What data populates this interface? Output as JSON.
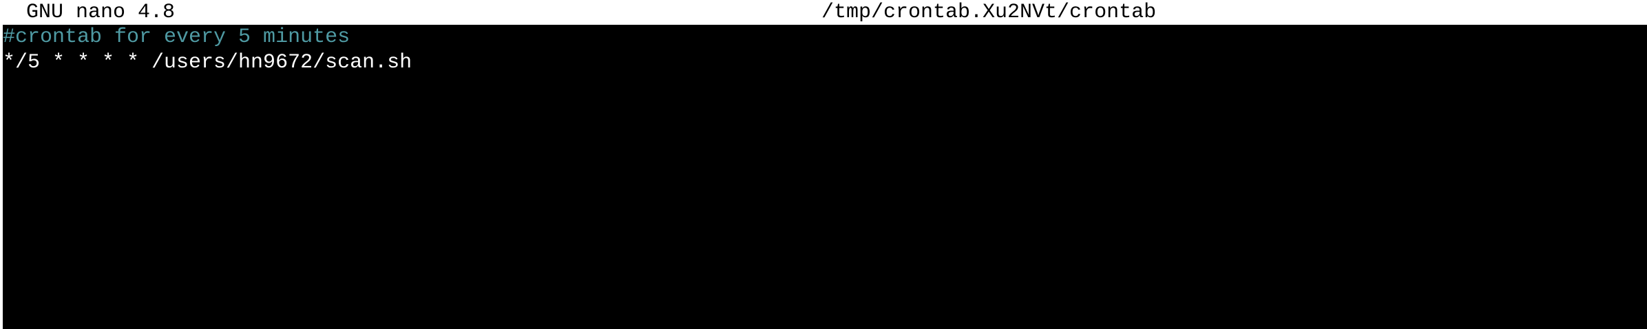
{
  "titlebar": {
    "app": "GNU nano 4.8",
    "filename": "/tmp/crontab.Xu2NVt/crontab"
  },
  "editor": {
    "lines": [
      {
        "text": "#crontab for every 5 minutes",
        "kind": "comment"
      },
      {
        "text": "*/5 * * * * /users/hn9672/scan.sh",
        "kind": "code"
      }
    ]
  },
  "colors": {
    "titlebar_bg": "#ffffff",
    "titlebar_fg": "#000000",
    "editor_bg": "#000000",
    "editor_fg": "#ffffff",
    "comment_fg": "#4f9aa3"
  }
}
